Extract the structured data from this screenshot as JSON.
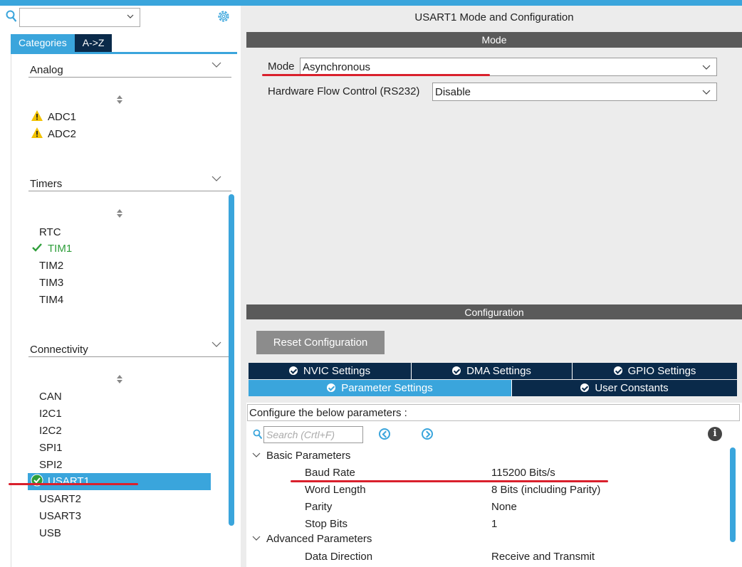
{
  "left": {
    "search": {
      "value": ""
    },
    "tabs": [
      {
        "label": "Categories"
      },
      {
        "label": "A->Z"
      }
    ],
    "sections": [
      {
        "label": "Analog",
        "items": [
          {
            "label": "ADC1",
            "status": "warning"
          },
          {
            "label": "ADC2",
            "status": "warning"
          }
        ]
      },
      {
        "label": "Timers",
        "items": [
          {
            "label": "RTC"
          },
          {
            "label": "TIM1",
            "status": "enabled"
          },
          {
            "label": "TIM2"
          },
          {
            "label": "TIM3"
          },
          {
            "label": "TIM4"
          }
        ]
      },
      {
        "label": "Connectivity",
        "items": [
          {
            "label": "CAN"
          },
          {
            "label": "I2C1"
          },
          {
            "label": "I2C2"
          },
          {
            "label": "SPI1"
          },
          {
            "label": "SPI2"
          },
          {
            "label": "USART1",
            "status": "selected"
          },
          {
            "label": "USART2"
          },
          {
            "label": "USART3"
          },
          {
            "label": "USB"
          }
        ]
      }
    ]
  },
  "right": {
    "title": "USART1 Mode and Configuration",
    "mode_bar": "Mode",
    "mode": {
      "label": "Mode",
      "value": "Asynchronous"
    },
    "flow": {
      "label": "Hardware Flow Control (RS232)",
      "value": "Disable"
    },
    "config_bar": "Configuration",
    "reset_label": "Reset Configuration",
    "tabs_row1": [
      {
        "label": "NVIC Settings"
      },
      {
        "label": "DMA Settings"
      },
      {
        "label": "GPIO Settings"
      }
    ],
    "tabs_row2": [
      {
        "label": "Parameter Settings",
        "active": true
      },
      {
        "label": "User Constants"
      }
    ],
    "hint": "Configure the below parameters :",
    "search_placeholder": "Search (Crtl+F)",
    "info_glyph": "i",
    "groups": {
      "basic": "Basic Parameters",
      "advanced": "Advanced Parameters"
    },
    "params": [
      {
        "name": "Baud Rate",
        "value": "115200 Bits/s"
      },
      {
        "name": "Word Length",
        "value": "8 Bits (including Parity)"
      },
      {
        "name": "Parity",
        "value": "None"
      },
      {
        "name": "Stop Bits",
        "value": "1"
      }
    ],
    "advanced_params": [
      {
        "name": "Data Direction",
        "value": "Receive and Transmit"
      }
    ]
  },
  "colors": {
    "accent": "#3aa5dc",
    "dark_tab": "#0a2a4a",
    "bar": "#5a5a5a",
    "annotation": "#d9202c",
    "enabled": "#2e9e3a",
    "warning": "#f2c200"
  }
}
